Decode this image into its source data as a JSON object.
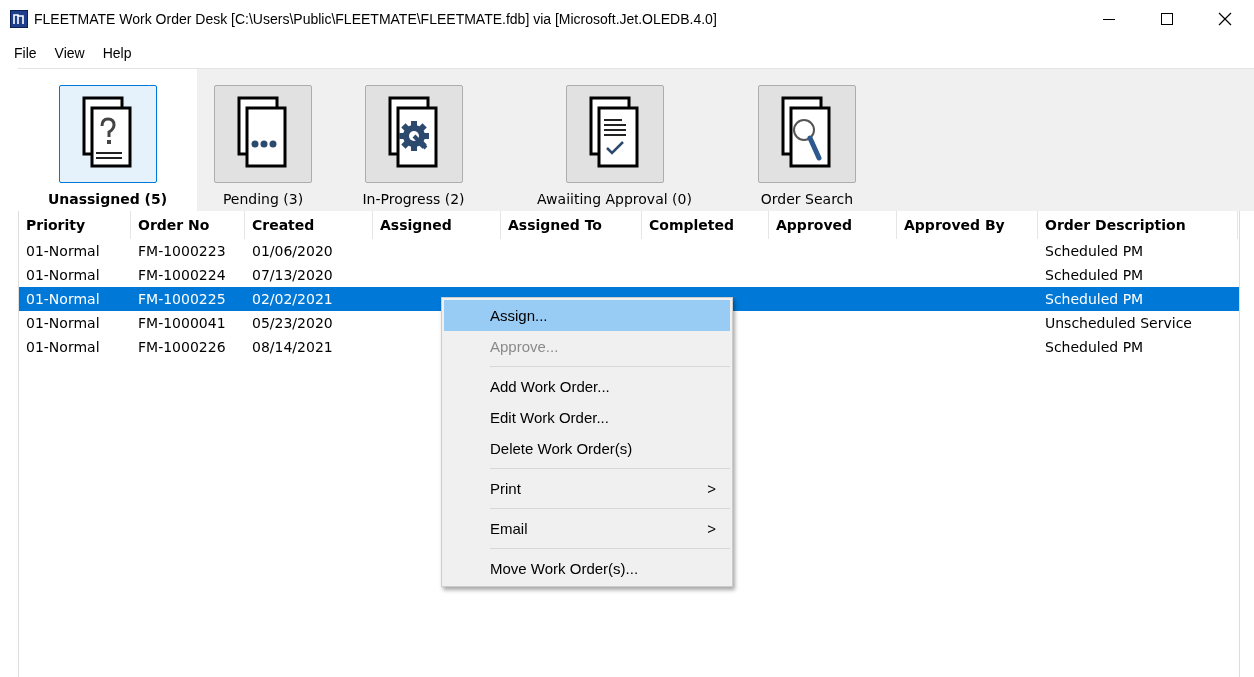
{
  "window": {
    "title": "FLEETMATE Work Order Desk [C:\\Users\\Public\\FLEETMATE\\FLEETMATE.fdb] via [Microsoft.Jet.OLEDB.4.0]"
  },
  "menu_bar": [
    "File",
    "View",
    "Help"
  ],
  "tabs": [
    {
      "label": "Unassigned (5)",
      "kind": "unassigned",
      "selected": true
    },
    {
      "label": "Pending (3)",
      "kind": "pending",
      "selected": false
    },
    {
      "label": "In-Progress (2)",
      "kind": "progress",
      "selected": false
    },
    {
      "label": "Awaiiting Approval (0)",
      "kind": "approval",
      "selected": false
    },
    {
      "label": "Order Search",
      "kind": "search",
      "selected": false
    }
  ],
  "table": {
    "columns": [
      "Priority",
      "Order No",
      "Created",
      "Assigned",
      "Assigned To",
      "Completed",
      "Approved",
      "Approved By",
      "Order Description"
    ],
    "rows": [
      {
        "cells": [
          "01-Normal",
          "FM-1000223",
          "01/06/2020",
          "",
          "",
          "",
          "",
          "",
          "Scheduled PM"
        ],
        "selected": false
      },
      {
        "cells": [
          "01-Normal",
          "FM-1000224",
          "07/13/2020",
          "",
          "",
          "",
          "",
          "",
          "Scheduled PM"
        ],
        "selected": false
      },
      {
        "cells": [
          "01-Normal",
          "FM-1000225",
          "02/02/2021",
          "",
          "",
          "",
          "",
          "",
          "Scheduled PM"
        ],
        "selected": true
      },
      {
        "cells": [
          "01-Normal",
          "FM-1000041",
          "05/23/2020",
          "",
          "",
          "",
          "",
          "",
          "Unscheduled Service"
        ],
        "selected": false
      },
      {
        "cells": [
          "01-Normal",
          "FM-1000226",
          "08/14/2021",
          "",
          "",
          "",
          "",
          "",
          "Scheduled PM"
        ],
        "selected": false
      }
    ]
  },
  "context_menu": {
    "items": [
      {
        "kind": "item",
        "label": "Assign...",
        "disabled": false,
        "selected": true
      },
      {
        "kind": "item",
        "label": "Approve...",
        "disabled": true,
        "selected": false
      },
      {
        "kind": "separator"
      },
      {
        "kind": "item",
        "label": "Add Work Order...",
        "disabled": false,
        "selected": false
      },
      {
        "kind": "item",
        "label": "Edit Work Order...",
        "disabled": false,
        "selected": false
      },
      {
        "kind": "item",
        "label": "Delete Work Order(s)",
        "disabled": false,
        "selected": false
      },
      {
        "kind": "separator"
      },
      {
        "kind": "item",
        "label": "Print",
        "disabled": false,
        "selected": false,
        "submenu": ">"
      },
      {
        "kind": "separator"
      },
      {
        "kind": "item",
        "label": "Email",
        "disabled": false,
        "selected": false,
        "submenu": ">"
      },
      {
        "kind": "separator"
      },
      {
        "kind": "item",
        "label": "Move Work Order(s)...",
        "disabled": false,
        "selected": false
      }
    ]
  }
}
